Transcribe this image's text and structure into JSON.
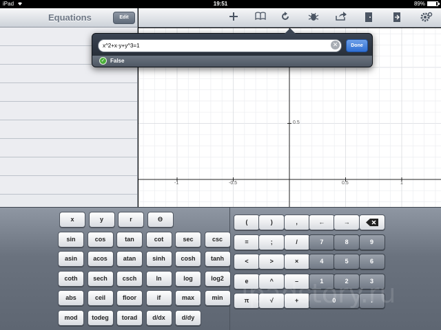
{
  "status_bar": {
    "carrier": "iPad",
    "time": "19:51",
    "battery": "89%",
    "battery_level": 0.89
  },
  "sidebar": {
    "title": "Equations",
    "edit_label": "Edit"
  },
  "toolbar": {
    "icons": [
      "plus-icon",
      "book-icon",
      "refresh-icon",
      "bug-icon",
      "share-icon",
      "door-icon",
      "exit-icon",
      "gear-icon"
    ]
  },
  "editor": {
    "input_value": "x^2+x·y+y^3=1",
    "done_label": "Done",
    "result_text": "False"
  },
  "graph": {
    "x_ticks": [
      "-1",
      "-0.5",
      "0.5",
      "1"
    ],
    "y_ticks": [
      "0.5"
    ]
  },
  "keyboard": {
    "functions": [
      [
        "x",
        "y",
        "r",
        "Θ"
      ],
      [
        "sin",
        "cos",
        "tan",
        "cot",
        "sec",
        "csc"
      ],
      [
        "asin",
        "acos",
        "atan",
        "sinh",
        "cosh",
        "tanh"
      ],
      [
        "coth",
        "sech",
        "csch",
        "ln",
        "log",
        "log2"
      ],
      [
        "abs",
        "ceil",
        "floor",
        "if",
        "max",
        "min"
      ],
      [
        "mod",
        "todeg",
        "torad",
        "d/dx",
        "d/dy"
      ]
    ],
    "operators": [
      [
        "(",
        ")",
        ",",
        "←",
        "→"
      ],
      [
        "=",
        ";",
        "/",
        "7",
        "8",
        "9"
      ],
      [
        "<",
        ">",
        "×",
        "4",
        "5",
        "6"
      ],
      [
        "e",
        "^",
        "–",
        "1",
        "2",
        "3"
      ],
      [
        "π",
        "√",
        "+",
        "0",
        "."
      ]
    ],
    "backspace_icon": "backspace-icon"
  },
  "watermark": "ipadstory.ru"
}
